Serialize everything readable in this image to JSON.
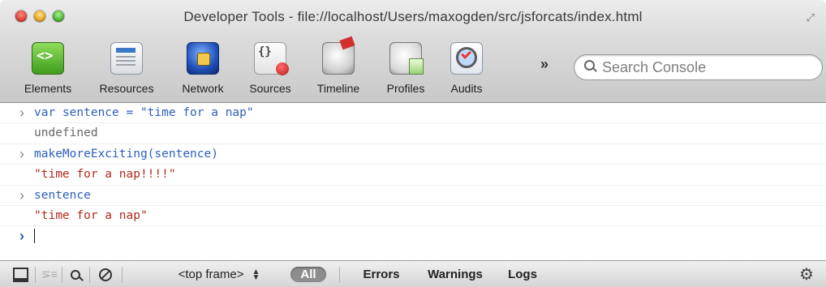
{
  "window": {
    "title": "Developer Tools - file://localhost/Users/maxogden/src/jsforcats/index.html"
  },
  "toolbar": {
    "panels": [
      {
        "label": "Elements",
        "icon": "elements-icon"
      },
      {
        "label": "Resources",
        "icon": "resources-icon"
      },
      {
        "label": "Network",
        "icon": "network-icon"
      },
      {
        "label": "Sources",
        "icon": "sources-icon"
      },
      {
        "label": "Timeline",
        "icon": "timeline-icon"
      },
      {
        "label": "Profiles",
        "icon": "profiles-icon"
      },
      {
        "label": "Audits",
        "icon": "audits-icon"
      }
    ],
    "overflow": "»",
    "search_placeholder": "Search Console"
  },
  "console": {
    "entries": [
      {
        "type": "input",
        "text": "var sentence = \"time for a nap\""
      },
      {
        "type": "result",
        "text": "undefined"
      },
      {
        "type": "input",
        "text": "makeMoreExciting(sentence)"
      },
      {
        "type": "result",
        "text": "\"time for a nap!!!!\""
      },
      {
        "type": "input",
        "text": "sentence"
      },
      {
        "type": "result",
        "text": "\"time for a nap\""
      }
    ]
  },
  "statusbar": {
    "frame": "<top frame>",
    "all": "All",
    "errors": "Errors",
    "warnings": "Warnings",
    "logs": "Logs"
  },
  "colors": {
    "input_text": "#2a5fbf",
    "string_result": "#b02a1c",
    "undefined_result": "#666666"
  }
}
